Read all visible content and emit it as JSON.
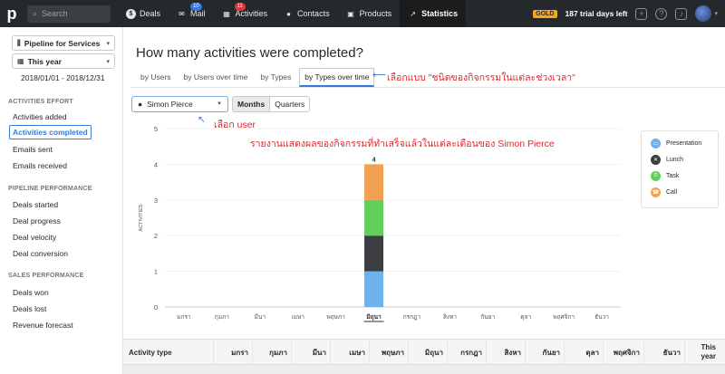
{
  "topbar": {
    "logo": "p",
    "search_placeholder": "Search",
    "nav": [
      {
        "label": "Deals",
        "icon": "dollar-icon"
      },
      {
        "label": "Mail",
        "icon": "mail-icon",
        "badge": "10"
      },
      {
        "label": "Activities",
        "icon": "calendar-icon",
        "badge": "11"
      },
      {
        "label": "Contacts",
        "icon": "person-icon"
      },
      {
        "label": "Products",
        "icon": "box-icon"
      },
      {
        "label": "Statistics",
        "icon": "trend-icon"
      }
    ],
    "gold": "GOLD",
    "trial": "187 trial days left"
  },
  "sidebar": {
    "pipeline": "Pipeline for Services",
    "period": "This year",
    "range": "2018/01/01 - 2018/12/31",
    "activities_effort_title": "ACTIVITIES EFFORT",
    "activities_effort": [
      "Activities added",
      "Activities completed",
      "Emails sent",
      "Emails received"
    ],
    "pipeline_perf_title": "PIPELINE PERFORMANCE",
    "pipeline_perf": [
      "Deals started",
      "Deal progress",
      "Deal velocity",
      "Deal conversion"
    ],
    "sales_perf_title": "SALES PERFORMANCE",
    "sales_perf": [
      "Deals won",
      "Deals lost",
      "Revenue forecast"
    ]
  },
  "main": {
    "title": "How many activities were completed?",
    "tabs": [
      "by Users",
      "by Users over time",
      "by Types",
      "by Types over time"
    ],
    "annotation_tab": "เลือกแบบ \"ชนิดของกิจกรรมในแต่ละช่วงเวลา\"",
    "annotation_user": "เลือก user",
    "annotation_chart": "รายงานแสดงผลของกิจกรรมที่ทำเสร็จแล้วในแต่ละเดือนของ Simon Pierce",
    "user": "Simon Pierce",
    "periods": [
      "Months",
      "Quarters"
    ]
  },
  "chart_data": {
    "type": "bar",
    "stacked": true,
    "ylabel": "ACTIVITIES",
    "ylim": [
      0,
      5
    ],
    "yticks": [
      0,
      1,
      2,
      3,
      4,
      5
    ],
    "categories": [
      "มกรา",
      "กุมภา",
      "มีนา",
      "เมษา",
      "พฤษภา",
      "มิถุนา",
      "กรกฎา",
      "สิงหา",
      "กันยา",
      "ตุลา",
      "พฤศจิกา",
      "ธันวา"
    ],
    "series": [
      {
        "name": "Presentation",
        "color": "#6fb1ea",
        "values": [
          0,
          0,
          0,
          0,
          0,
          1,
          0,
          0,
          0,
          0,
          0,
          0
        ]
      },
      {
        "name": "Lunch",
        "color": "#3b3d40",
        "values": [
          0,
          0,
          0,
          0,
          0,
          1,
          0,
          0,
          0,
          0,
          0,
          0
        ]
      },
      {
        "name": "Task",
        "color": "#5fd05b",
        "values": [
          0,
          0,
          0,
          0,
          0,
          1,
          0,
          0,
          0,
          0,
          0,
          0
        ]
      },
      {
        "name": "Call",
        "color": "#f2a052",
        "values": [
          0,
          0,
          0,
          0,
          0,
          1,
          0,
          0,
          0,
          0,
          0,
          0
        ]
      }
    ],
    "data_labels": [
      {
        "category": "มิถุนา",
        "value": "4"
      }
    ],
    "legend_position": "right",
    "highlight_category": "มิถุนา"
  },
  "table": {
    "first_header": "Activity type",
    "last_header_line1": "This",
    "last_header_line2": "year"
  }
}
